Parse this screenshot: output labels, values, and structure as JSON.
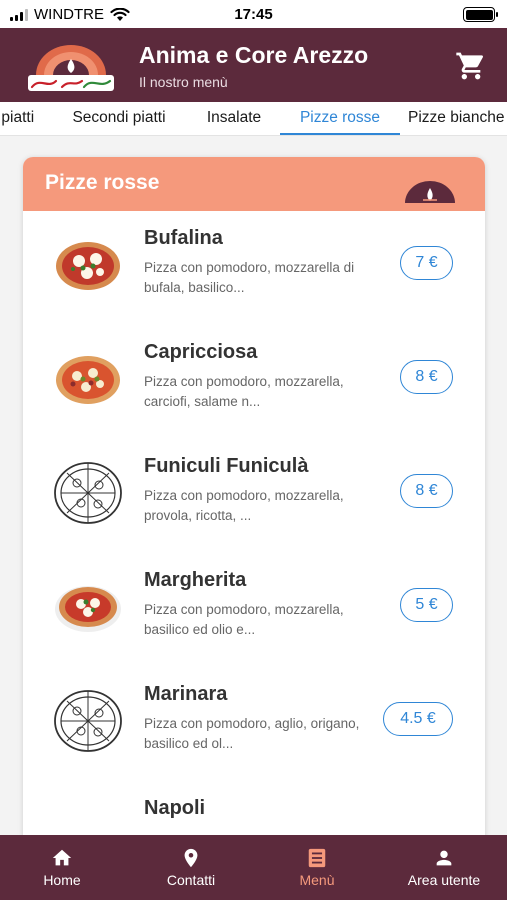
{
  "status_bar": {
    "carrier": "WINDTRE",
    "time": "17:45"
  },
  "header": {
    "title": "Anima e Core Arezzo",
    "subtitle": "Il nostro menù",
    "logo_text": "Anima e Core"
  },
  "tabs": [
    {
      "label": "Primi piatti",
      "active": false
    },
    {
      "label": "Secondi piatti",
      "active": false
    },
    {
      "label": "Insalate",
      "active": false
    },
    {
      "label": "Pizze rosse",
      "active": true
    },
    {
      "label": "Pizze bianche",
      "active": false
    }
  ],
  "category": {
    "title": "Pizze rosse"
  },
  "items": [
    {
      "name": "Bufalina",
      "description": "Pizza con pomodoro, mozzarella di bufala, basilico...",
      "price": "7 €",
      "image": "pizza-photo"
    },
    {
      "name": "Capricciosa",
      "description": "Pizza con pomodoro, mozzarella, carciofi, salame n...",
      "price": "8 €",
      "image": "pizza-photo"
    },
    {
      "name": "Funiculi Funiculà",
      "description": "Pizza con pomodoro, mozzarella, provola, ricotta, ...",
      "price": "8 €",
      "image": "pizza-sketch"
    },
    {
      "name": "Margherita",
      "description": "Pizza con pomodoro, mozzarella, basilico ed olio e...",
      "price": "5 €",
      "image": "pizza-photo"
    },
    {
      "name": "Marinara",
      "description": "Pizza con pomodoro, aglio, origano, basilico ed ol...",
      "price": "4.5 €",
      "image": "pizza-sketch"
    },
    {
      "name": "Napoli",
      "description": "",
      "price": "",
      "image": ""
    }
  ],
  "bottom_nav": [
    {
      "label": "Home",
      "icon": "home-icon",
      "active": false
    },
    {
      "label": "Contatti",
      "icon": "location-pin-icon",
      "active": false
    },
    {
      "label": "Menù",
      "icon": "menu-list-icon",
      "active": true
    },
    {
      "label": "Area utente",
      "icon": "user-icon",
      "active": false
    }
  ],
  "colors": {
    "header_bg": "#5c2a3c",
    "accent_salmon": "#f5997c",
    "link_blue": "#2f86d6"
  }
}
